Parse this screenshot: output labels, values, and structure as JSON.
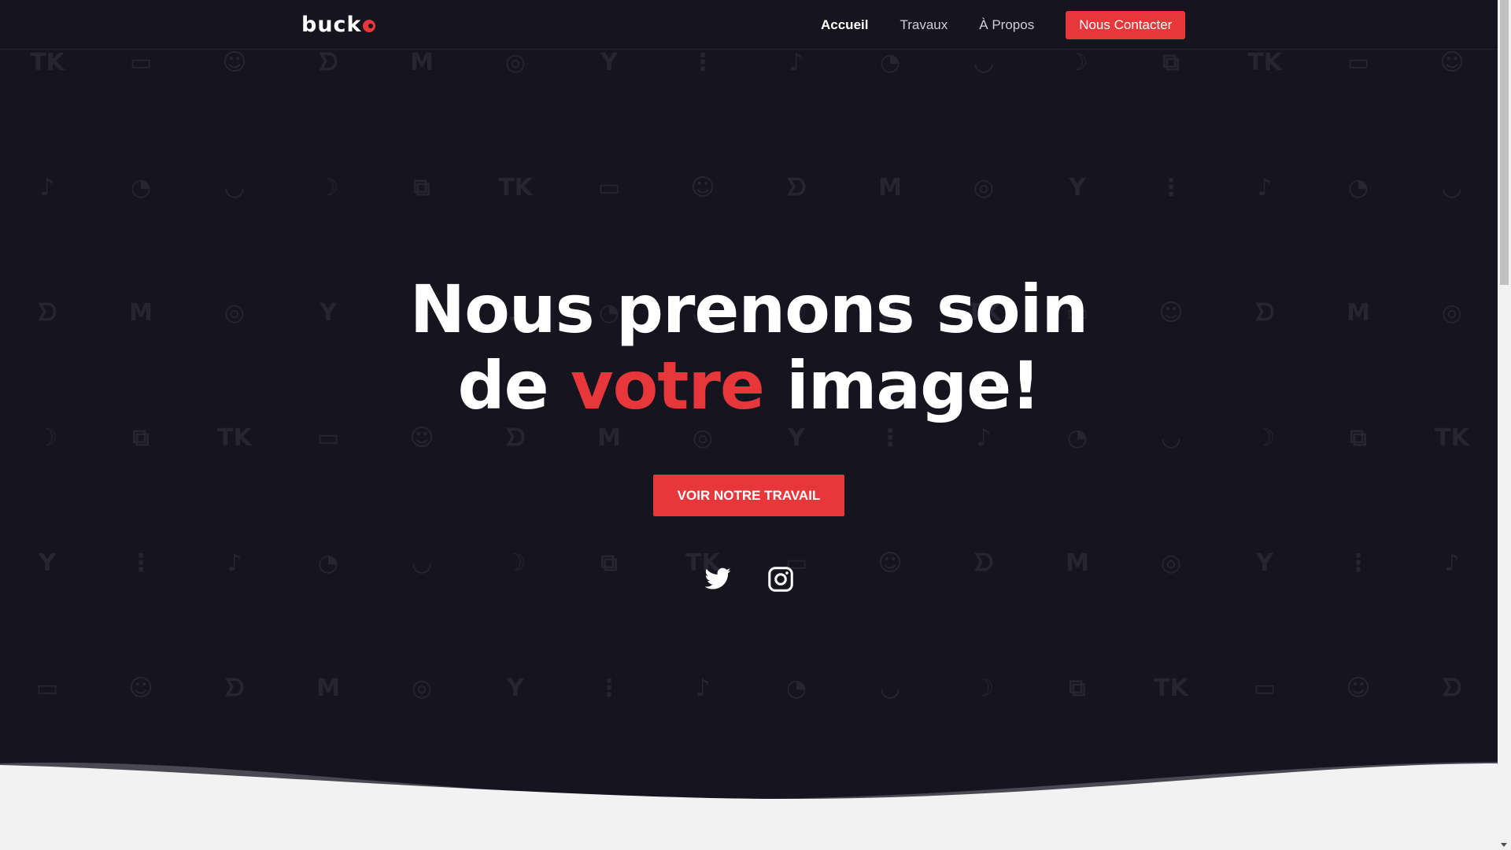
{
  "header": {
    "logo_text": "buck",
    "nav": [
      {
        "label": "Accueil",
        "active": true
      },
      {
        "label": "Travaux",
        "active": false
      },
      {
        "label": "À Propos",
        "active": false
      }
    ],
    "contact_label": "Nous Contacter"
  },
  "hero": {
    "line1": "Nous prenons soin",
    "line2_pre": "de ",
    "line2_accent": "votre",
    "line2_post": " image!",
    "cta_label": "VOIR NOTRE TRAVAIL"
  },
  "social": {
    "twitter_icon": "twitter-icon",
    "instagram_icon": "instagram-icon"
  },
  "colors": {
    "background": "#16141f",
    "accent": "#e8373b",
    "text": "#ffffff",
    "section_bg": "#f2f2f2"
  }
}
